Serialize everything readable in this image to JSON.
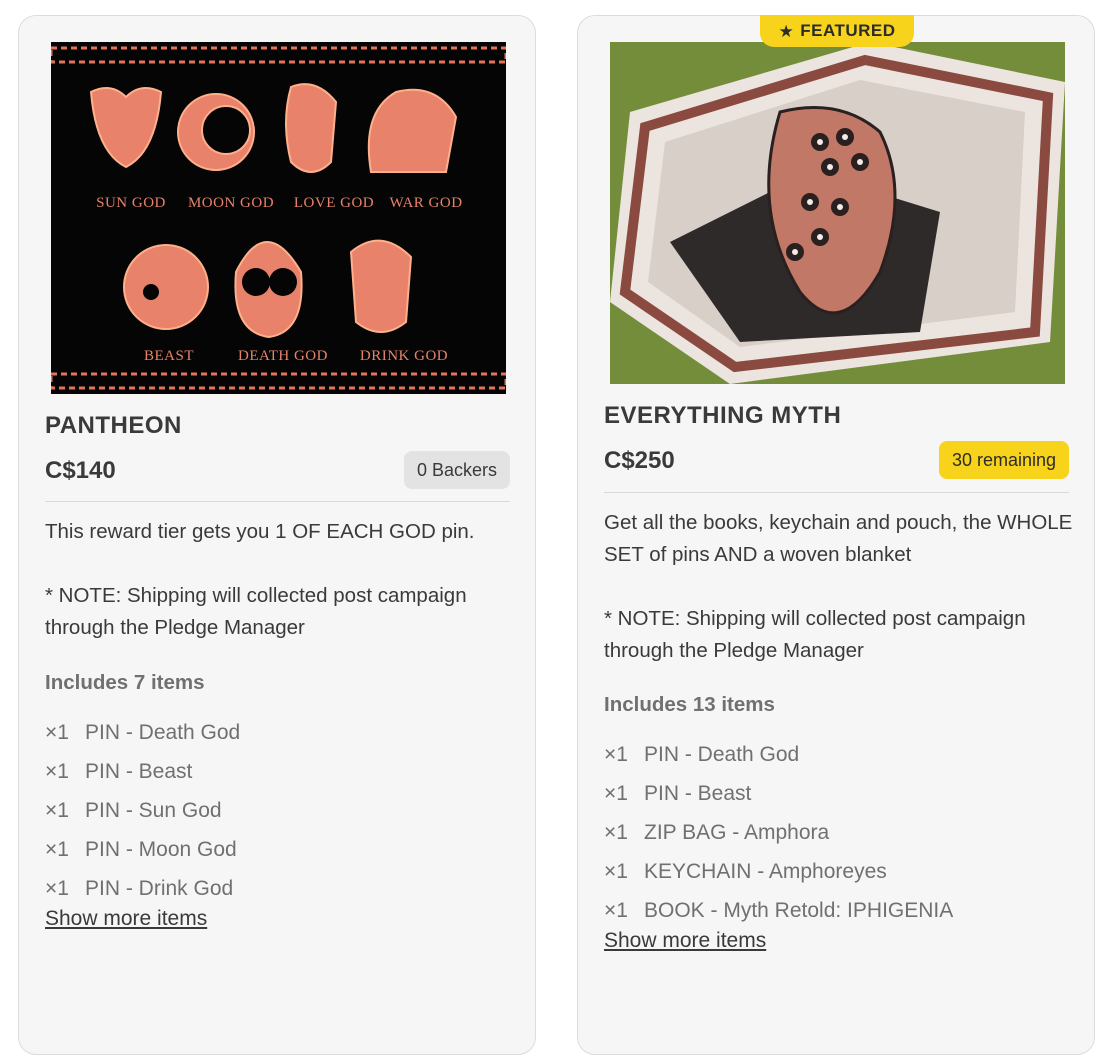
{
  "rewards": [
    {
      "title": "PANTHEON",
      "price": "C$140",
      "badge": "0 Backers",
      "description": "This reward tier gets you 1 OF EACH GOD pin.\n\n* NOTE: Shipping will collected post campaign through the Pledge Manager",
      "includes": "Includes 7 items",
      "items": [
        {
          "qty": "×1",
          "name": "PIN - Death God"
        },
        {
          "qty": "×1",
          "name": "PIN - Beast"
        },
        {
          "qty": "×1",
          "name": "PIN - Sun God"
        },
        {
          "qty": "×1",
          "name": "PIN - Moon God"
        },
        {
          "qty": "×1",
          "name": "PIN - Drink God"
        }
      ],
      "show_more": "Show more items",
      "image_labels": [
        "SUN GOD",
        "MOON GOD",
        "LOVE GOD",
        "WAR GOD",
        "BEAST",
        "DEATH GOD",
        "DRINK GOD"
      ]
    },
    {
      "featured_label": "FEATURED",
      "title": "EVERYTHING MYTH",
      "price": "C$250",
      "badge": "30 remaining",
      "description": "Get all the books, keychain and pouch, the WHOLE SET of pins AND a woven blanket\n\n* NOTE: Shipping will collected post campaign through the Pledge Manager",
      "includes": "Includes 13 items",
      "items": [
        {
          "qty": "×1",
          "name": "PIN - Death God"
        },
        {
          "qty": "×1",
          "name": "PIN - Beast"
        },
        {
          "qty": "×1",
          "name": "ZIP BAG - Amphora"
        },
        {
          "qty": "×1",
          "name": "KEYCHAIN - Amphoreyes"
        },
        {
          "qty": "×1",
          "name": "BOOK - Myth Retold: IPHIGENIA"
        }
      ],
      "show_more": "Show more items"
    }
  ],
  "icons": {
    "featured": "star-icon"
  },
  "colors": {
    "accent_yellow": "#f7d31b",
    "card_bg": "#f6f6f6",
    "pin_glow": "#f08a5d"
  }
}
